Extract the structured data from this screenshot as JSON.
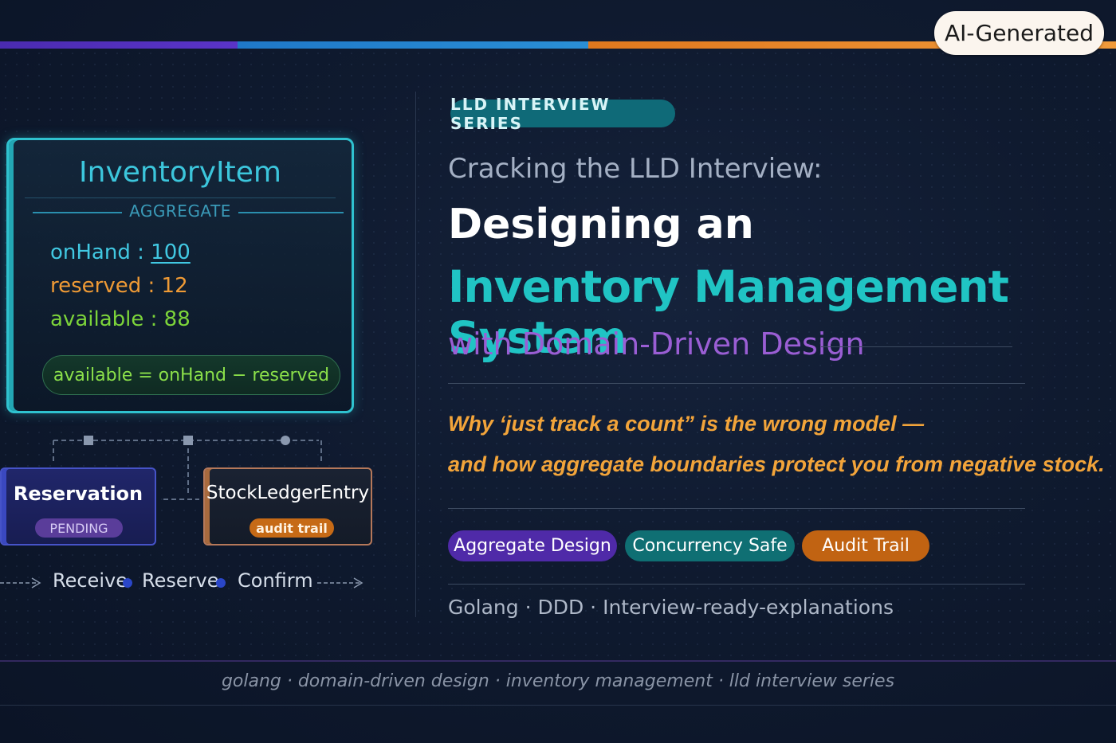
{
  "badge": {
    "label": "AI-Generated"
  },
  "aggregate_card": {
    "title": "InventoryItem",
    "subtitle": "AGGREGATE",
    "fields": [
      {
        "name": "onHand",
        "value": "100"
      },
      {
        "name": "reserved",
        "value": "12"
      },
      {
        "name": "available",
        "value": "88"
      }
    ],
    "formula": "available = onHand − reserved"
  },
  "entities": {
    "reservation": {
      "title": "Reservation",
      "status": "PENDING"
    },
    "ledger": {
      "title": "StockLedgerEntry",
      "tag": "audit trail"
    }
  },
  "flow": {
    "steps": [
      "Receive",
      "Reserve",
      "Confirm"
    ]
  },
  "header": {
    "series": "LLD INTERVIEW SERIES",
    "subtitle": "Cracking the LLD Interview:",
    "title_line1": "Designing an",
    "title_line2": "Inventory Management System",
    "title_line3": "with Domain-Driven Design"
  },
  "tagline": {
    "line1": "Why ‘just track a count” is the wrong model —",
    "line2": "and how aggregate boundaries protect you from negative stock."
  },
  "tags": [
    "Aggregate Design",
    "Concurrency Safe",
    "Audit Trail"
  ],
  "techs": "Golang · DDD · Interview-ready-explanations",
  "footer": "golang · domain-driven design · inventory management · lld interview series",
  "colors": {
    "teal": "#20c4c4",
    "purple": "#9a5ed4",
    "orange": "#f2a43a",
    "green": "#7cd43a"
  }
}
